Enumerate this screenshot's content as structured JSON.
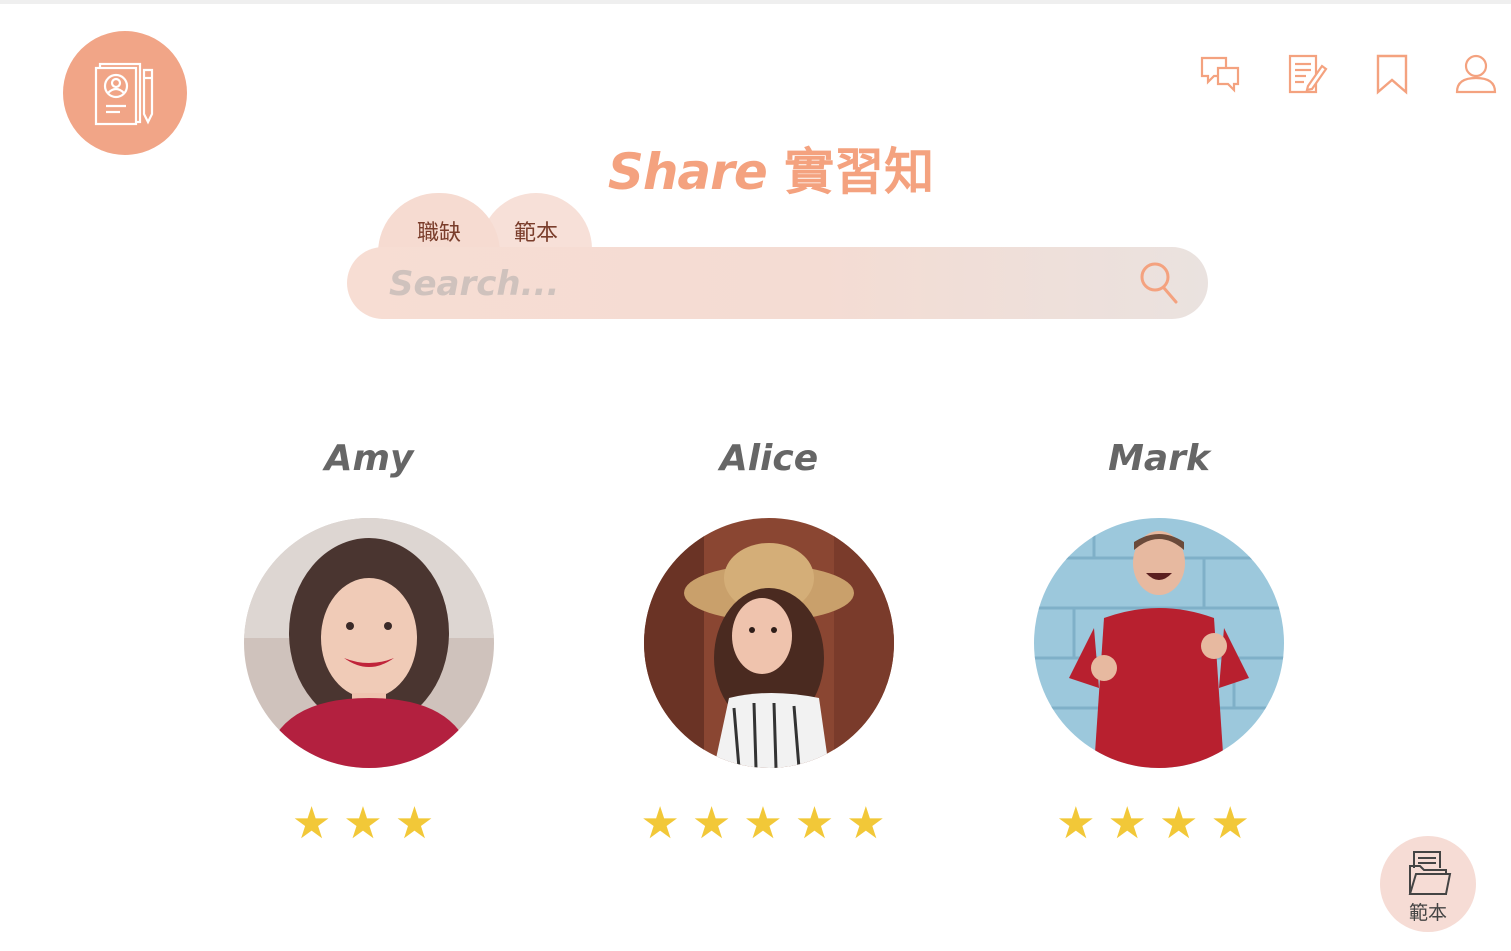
{
  "app": {
    "brand_en": "Share",
    "brand_zh": "實習知"
  },
  "colors": {
    "accent": "#f4a27f",
    "logo_bg": "#f1a587",
    "search_bg": "#f6dcd3",
    "star": "#f2c838",
    "name_text": "#666666"
  },
  "header": {
    "icons": [
      "chat-icon",
      "edit-note-icon",
      "bookmark-icon",
      "user-icon"
    ]
  },
  "search": {
    "tabs": [
      {
        "label": "職缺"
      },
      {
        "label": "範本"
      }
    ],
    "placeholder": "Search...",
    "value": ""
  },
  "profiles": [
    {
      "name": "Amy",
      "rating": 3,
      "stars": "★★★"
    },
    {
      "name": "Alice",
      "rating": 5,
      "stars": "★★★★★"
    },
    {
      "name": "Mark",
      "rating": 4,
      "stars": "★★★★"
    }
  ],
  "fab": {
    "icon": "folder-document-icon",
    "label": "範本"
  }
}
